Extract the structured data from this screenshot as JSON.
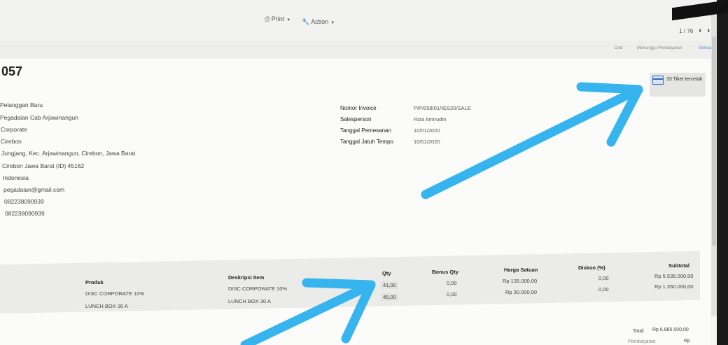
{
  "toolbar": {
    "print_label": "Print",
    "action_label": "Action",
    "pager_text": "1 / 76",
    "prev_icon": "chevron-left-icon",
    "next_icon": "chevron-right-icon"
  },
  "statusbar": {
    "stages": [
      "Draf",
      "Menunggu Pembayaran",
      "Selesai"
    ]
  },
  "document": {
    "number": "057",
    "ticket_button": {
      "icon": "credit-card-icon",
      "label": "33 Tiket tercetak"
    }
  },
  "customer": {
    "lines": [
      "Pelanggan Baru",
      "Pegadaian Cab Arjawinangun",
      "Corporate",
      "Cirebon",
      "Jungjang, Kec. Arjawinangun, Cirebon, Jawa Barat",
      "Cirebon   Jawa Barat (ID)   45162",
      "Indonesia",
      "pegadaian@gmail.com",
      "082238090939",
      "082238090939"
    ]
  },
  "invoice_info": {
    "fields": [
      {
        "label": "Nomor Invoice",
        "value": "PIP/058/01/IGS20/SALE"
      },
      {
        "label": "Salesperson",
        "value": "Riza Amirudin"
      },
      {
        "label": "Tanggal Pemesanan",
        "value": "10/01/2020"
      },
      {
        "label": "Tanggal Jatuh Tempo",
        "value": "10/01/2020"
      }
    ]
  },
  "lines_table": {
    "headers": {
      "produk": "Produk",
      "deskripsi": "Deskripsi Item",
      "qty": "Qty",
      "bonus": "Bonus Qty",
      "harga": "Harga Satuan",
      "diskon": "Diskon (%)",
      "subtotal": "Subtotal"
    },
    "rows": [
      {
        "produk": "DISC CORPORATE 10%",
        "deskripsi": "DISC CORPORATE 10%",
        "qty": "41,00",
        "bonus": "0,00",
        "harga": "Rp 135.000,00",
        "diskon": "0,00",
        "subtotal": "Rp 5.535.000,00"
      },
      {
        "produk": "LUNCH BOX 30 A",
        "deskripsi": "LUNCH BOX 30 A",
        "qty": "45,00",
        "bonus": "0,00",
        "harga": "Rp 30.000,00",
        "diskon": "0,00",
        "subtotal": "Rp 1.350.000,00"
      }
    ]
  },
  "totals": {
    "total_label": "Total:",
    "total_value": "Rp 6.885.000,00",
    "payment_label": "Pembayaran",
    "payment_value": "Rp"
  },
  "colors": {
    "annotation_arrow": "#35b4ee",
    "card_icon": "#2f6db3"
  }
}
